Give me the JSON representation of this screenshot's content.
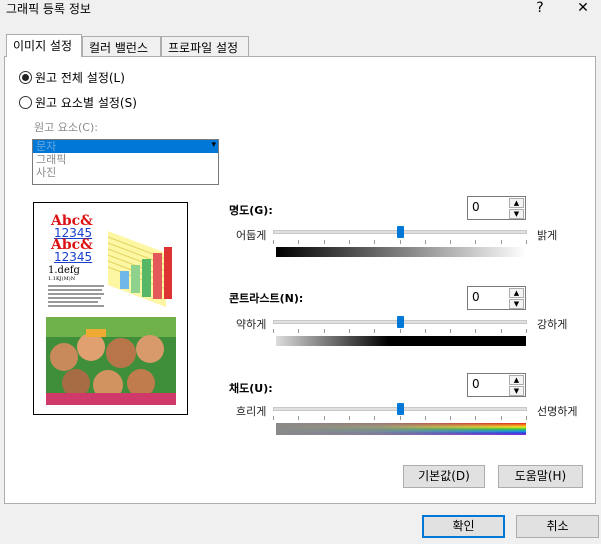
{
  "window": {
    "title": "그래픽 등록 정보",
    "help": "?",
    "close": "✕"
  },
  "tabs": [
    {
      "label": "이미지 설정"
    },
    {
      "label": "컬러 밸런스"
    },
    {
      "label": "프로파일 설정"
    }
  ],
  "source": {
    "all_label": "원고 전체 설정(L)",
    "per_element_label": "원고 요소별 설정(S)",
    "element_caption": "원고 요소(C):",
    "elements": [
      "문자",
      "그래픽",
      "사진"
    ]
  },
  "preview": {
    "title1": "Abc&",
    "num1": "12345",
    "title2": "Abc&",
    "num2": "12345",
    "small": "1.defg",
    "tiny": "1.1KJ(M)N"
  },
  "brightness": {
    "label": "명도(G):",
    "value": "0",
    "left": "어둡게",
    "right": "밝게",
    "level": 0.5
  },
  "contrast": {
    "label": "콘트라스트(N):",
    "value": "0",
    "left": "약하게",
    "right": "강하게",
    "level": 0.5
  },
  "saturation": {
    "label": "채도(U):",
    "value": "0",
    "left": "흐리게",
    "right": "선명하게",
    "level": 0.5
  },
  "buttons": {
    "default": "기본값(D)",
    "help": "도움말(H)",
    "ok": "확인",
    "cancel": "취소"
  }
}
